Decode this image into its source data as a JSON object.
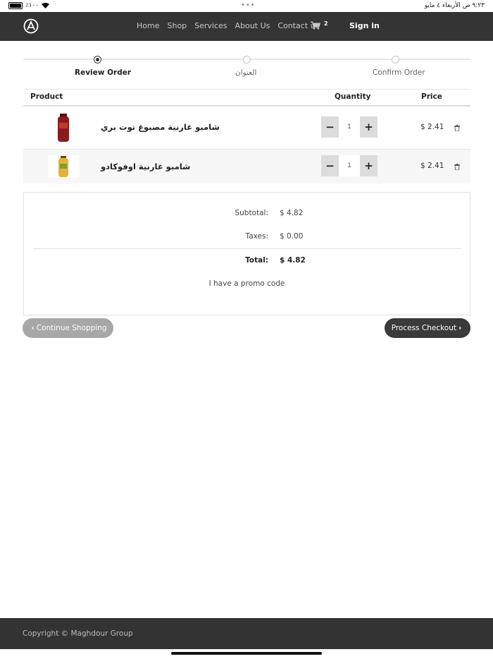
{
  "status_bar": {
    "battery": "٪١٠٠",
    "time_date": "٩:٢٣ ص   الأربعاء ٤ مايو"
  },
  "nav": {
    "links": [
      "Home",
      "Shop",
      "Services",
      "About Us",
      "Contact us"
    ],
    "cart_count": "2",
    "sign_in": "Sign in"
  },
  "steps": [
    "Review Order",
    "العنوان",
    "Confirm Order"
  ],
  "table": {
    "headers": {
      "product": "Product",
      "quantity": "Quantity",
      "price": "Price"
    },
    "rows": [
      {
        "name": "شامبو غارنية مصبوغ توت بري",
        "qty": "1",
        "price": "$ 2.41",
        "image_color": "#8b1a1f"
      },
      {
        "name": "شامبو غارنية اوفوكادو",
        "qty": "1",
        "price": "$ 2.41",
        "image_color": "#e3b23c"
      }
    ]
  },
  "summary": {
    "subtotal_label": "Subtotal:",
    "subtotal": "$ 4.82",
    "taxes_label": "Taxes:",
    "taxes": "$ 0.00",
    "total_label": "Total:",
    "total": "$ 4.82",
    "promo": "I have a promo code"
  },
  "buttons": {
    "continue": "Continue Shopping",
    "checkout": "Process Checkout"
  },
  "footer": {
    "copyright": "Copyright © Maghdour Group"
  }
}
